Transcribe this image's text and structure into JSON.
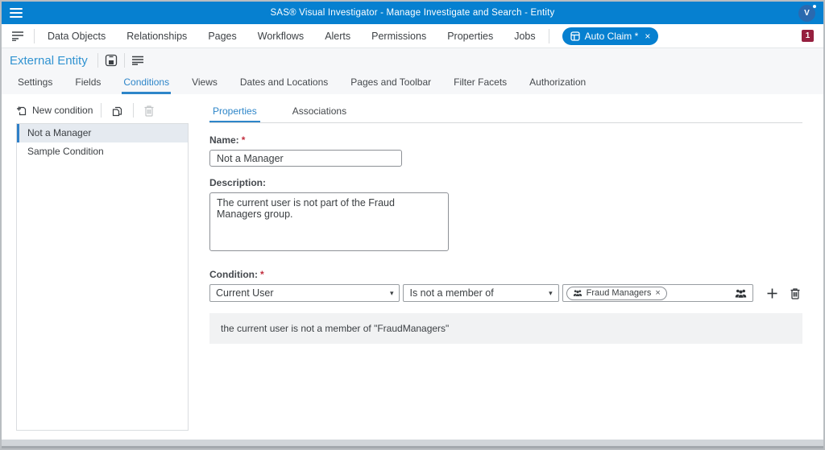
{
  "titlebar": {
    "title": "SAS® Visual Investigator - Manage Investigate and Search - Entity",
    "avatar_initial": "V"
  },
  "navbar": {
    "items": [
      "Data Objects",
      "Relationships",
      "Pages",
      "Workflows",
      "Alerts",
      "Permissions",
      "Properties",
      "Jobs"
    ],
    "open_item": {
      "label": "Auto Claim *",
      "close_glyph": "×"
    },
    "notification_count": "1"
  },
  "entity_header": {
    "title": "External Entity"
  },
  "main_tabs": {
    "items": [
      "Settings",
      "Fields",
      "Conditions",
      "Views",
      "Dates and Locations",
      "Pages and Toolbar",
      "Filter Facets",
      "Authorization"
    ],
    "active": "Conditions"
  },
  "conditions_panel": {
    "new_condition_label": "New condition",
    "items": [
      {
        "label": "Not a Manager",
        "selected": true
      },
      {
        "label": "Sample Condition",
        "selected": false
      }
    ]
  },
  "detail": {
    "tabs": [
      "Properties",
      "Associations"
    ],
    "active_tab": "Properties",
    "required_marker": "*",
    "name": {
      "label": "Name:",
      "value": "Not a Manager"
    },
    "description": {
      "label": "Description:",
      "value": "The current user is not part of the Fraud Managers group."
    },
    "condition": {
      "label": "Condition:",
      "subject": "Current User",
      "operator": "Is not a member of",
      "value_tag": "Fraud Managers",
      "tag_close_glyph": "×",
      "caret_glyph": "▾"
    },
    "summary": "the current user is not a member of \"FraudManagers\""
  },
  "colors": {
    "topbar_blue": "#0680d0",
    "accent_blue": "#2e86c9",
    "badge_maroon": "#96203f",
    "selected_item_bg": "#e5eaf0"
  }
}
